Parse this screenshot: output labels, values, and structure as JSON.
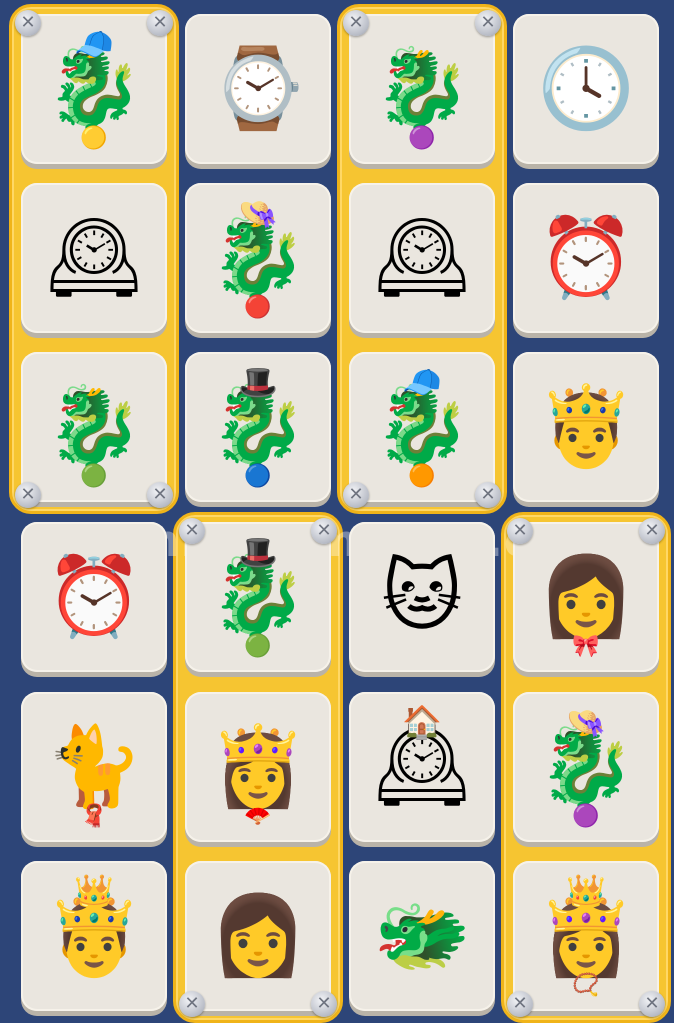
{
  "watermark": "Connect-master.org",
  "colors": {
    "board": "#2d4578",
    "group": "#f6c531",
    "tile": "#eae6df"
  },
  "groups": [
    {
      "name": "group-col1-top",
      "cols": [
        0
      ],
      "rows": [
        0,
        2
      ]
    },
    {
      "name": "group-col3-top",
      "cols": [
        2
      ],
      "rows": [
        0,
        2
      ]
    },
    {
      "name": "group-col2-bottom",
      "cols": [
        1
      ],
      "rows": [
        3,
        5
      ]
    },
    {
      "name": "group-col4-bottom",
      "cols": [
        3
      ],
      "rows": [
        3,
        5
      ]
    }
  ],
  "tiles": [
    {
      "id": "dragon-green-beanie-yellow-glasses",
      "col": 0,
      "row": 0,
      "glyph": "🐉",
      "top": "🧢",
      "mark": "🟡"
    },
    {
      "id": "smartwatch",
      "col": 1,
      "row": 0,
      "glyph": "⌚",
      "top": "",
      "mark": ""
    },
    {
      "id": "dragon-purple-glasses",
      "col": 2,
      "row": 0,
      "glyph": "🐉",
      "top": "",
      "mark": "🟣"
    },
    {
      "id": "orange-wall-clock",
      "col": 3,
      "row": 0,
      "glyph": "🕓",
      "top": "",
      "mark": ""
    },
    {
      "id": "black-mantel-clock",
      "col": 0,
      "row": 1,
      "glyph": "🕰",
      "top": "",
      "mark": ""
    },
    {
      "id": "dragon-straw-hat-red-glasses",
      "col": 1,
      "row": 1,
      "glyph": "🐉",
      "top": "👒",
      "mark": "🔴"
    },
    {
      "id": "ornate-wall-clock",
      "col": 2,
      "row": 1,
      "glyph": "🕰",
      "top": "",
      "mark": ""
    },
    {
      "id": "orange-alarm-clock",
      "col": 3,
      "row": 1,
      "glyph": "⏰",
      "top": "",
      "mark": ""
    },
    {
      "id": "dragon-green-glasses",
      "col": 0,
      "row": 2,
      "glyph": "🐉",
      "top": "",
      "mark": "🟢"
    },
    {
      "id": "dragon-blue-hat-blue-glasses",
      "col": 1,
      "row": 2,
      "glyph": "🐉",
      "top": "🎩",
      "mark": "🔵"
    },
    {
      "id": "dragon-purple-beanie-orange-glasses",
      "col": 2,
      "row": 2,
      "glyph": "🐉",
      "top": "🧢",
      "mark": "🟠"
    },
    {
      "id": "king-red-beard",
      "col": 3,
      "row": 2,
      "glyph": "🤴",
      "top": "",
      "mark": ""
    },
    {
      "id": "black-alarm-clock",
      "col": 0,
      "row": 3,
      "glyph": "⏰",
      "top": "",
      "mark": ""
    },
    {
      "id": "dragon-top-hat-green-glasses",
      "col": 1,
      "row": 3,
      "glyph": "🐉",
      "top": "🎩",
      "mark": "🟢"
    },
    {
      "id": "ginger-cat-vest",
      "col": 2,
      "row": 3,
      "glyph": "🐱",
      "top": "",
      "mark": ""
    },
    {
      "id": "woman-bonnet",
      "col": 3,
      "row": 3,
      "glyph": "👩",
      "top": "",
      "mark": "🎀"
    },
    {
      "id": "black-cat-scarf",
      "col": 0,
      "row": 4,
      "glyph": "🐈",
      "top": "",
      "mark": "🧣"
    },
    {
      "id": "woman-fan-tiara",
      "col": 1,
      "row": 4,
      "glyph": "👸",
      "top": "",
      "mark": "🪭"
    },
    {
      "id": "cuckoo-clock",
      "col": 2,
      "row": 4,
      "glyph": "🕰",
      "top": "🏠",
      "mark": ""
    },
    {
      "id": "dragon-purple-hat-purple-glasses",
      "col": 3,
      "row": 4,
      "glyph": "🐉",
      "top": "👒",
      "mark": "🟣"
    },
    {
      "id": "king-crown",
      "col": 0,
      "row": 5,
      "glyph": "🤴",
      "top": "👑",
      "mark": ""
    },
    {
      "id": "woman-red-hair",
      "col": 1,
      "row": 5,
      "glyph": "👩",
      "top": "",
      "mark": ""
    },
    {
      "id": "golden-dragon",
      "col": 2,
      "row": 5,
      "glyph": "🐲",
      "top": "",
      "mark": ""
    },
    {
      "id": "queen-crown-braids",
      "col": 3,
      "row": 5,
      "glyph": "👸",
      "top": "👑",
      "mark": "📿"
    }
  ]
}
